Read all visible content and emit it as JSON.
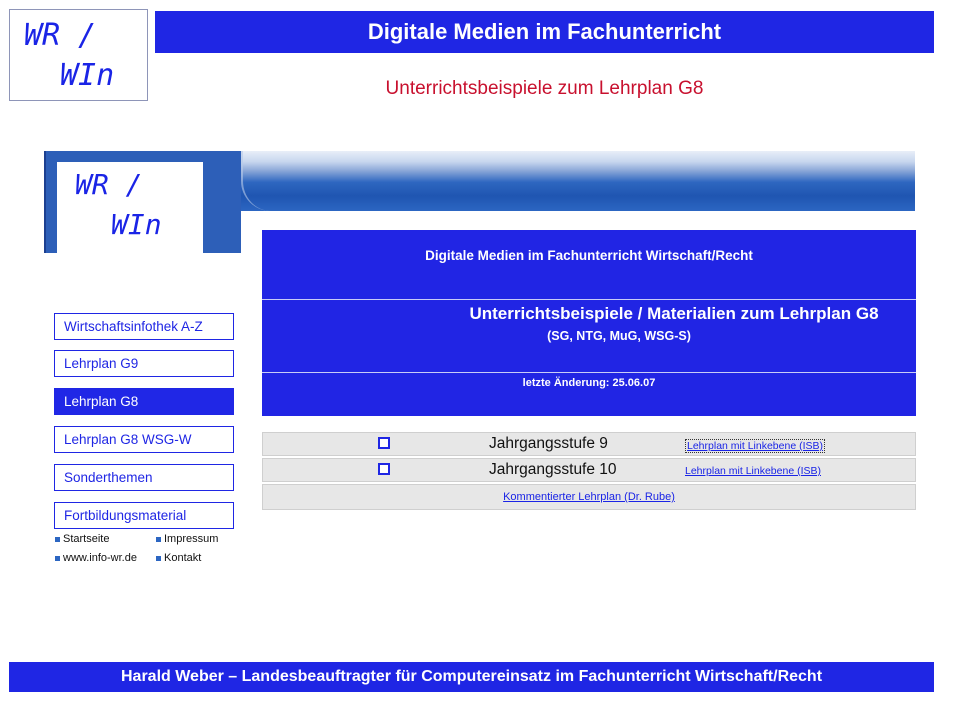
{
  "slide": {
    "logo": {
      "line1": "WR /",
      "line2": "WIn"
    },
    "title": "Digitale Medien im Fachunterricht",
    "subtitle": "Unterrichtsbeispiele zum Lehrplan G8",
    "footer": "Harald Weber – Landesbeauftragter für Computereinsatz im Fachunterricht Wirtschaft/Recht"
  },
  "site": {
    "logo": {
      "line1": "WR /",
      "line2": "WIn"
    },
    "nav": [
      {
        "label": "Wirtschaftsinfothek A-Z",
        "active": false
      },
      {
        "label": "Lehrplan G9",
        "active": false
      },
      {
        "label": "Lehrplan G8",
        "active": true
      },
      {
        "label": "Lehrplan G8 WSG-W",
        "active": false
      },
      {
        "label": "Sonderthemen",
        "active": false
      },
      {
        "label": "Fortbildungsmaterial",
        "active": false
      }
    ],
    "small_links": [
      "Startseite",
      "Impressum",
      "www.info-wr.de",
      "Kontakt"
    ],
    "content": {
      "header": "Digitale Medien im Fachunterricht Wirtschaft/Recht",
      "heading": "Unterrichtsbeispiele / Materialien zum Lehrplan G8",
      "subheading": "(SG, NTG, MuG, WSG-S)",
      "updated": "letzte Änderung: 25.06.07"
    },
    "table": {
      "rows": [
        {
          "grade": "Jahrgangsstufe 9",
          "link": "Lehrplan mit Linkebene (ISB)"
        },
        {
          "grade": "Jahrgangsstufe 10",
          "link": "Lehrplan mit Linkebene (ISB)"
        }
      ],
      "footer_link": "Kommentierter Lehrplan (Dr. Rube)"
    },
    "colors": {
      "primary": "#1f26e4",
      "accent_red": "#c8102e",
      "banner_blue": "#2c66c2"
    }
  }
}
